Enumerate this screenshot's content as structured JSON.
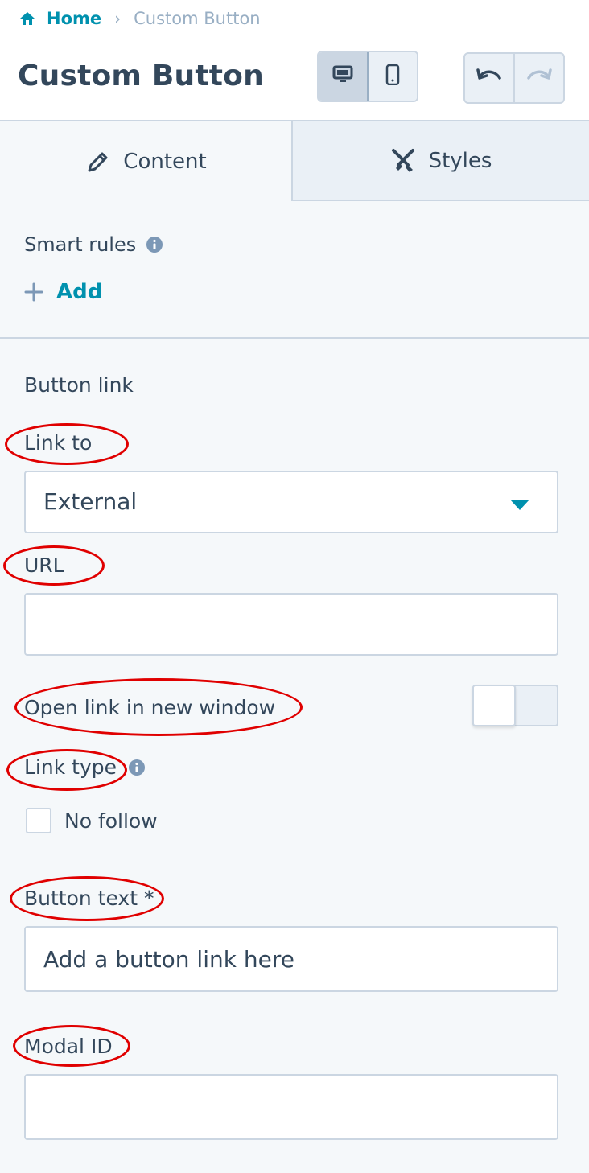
{
  "breadcrumb": {
    "home_icon": "home-icon",
    "home_label": "Home",
    "separator": "›",
    "current_label": "Custom Button"
  },
  "header": {
    "title": "Custom Button",
    "device_toggle": {
      "desktop_icon": "desktop-icon",
      "mobile_icon": "mobile-icon",
      "active": "desktop"
    },
    "history": {
      "undo_icon": "undo-icon",
      "redo_icon": "redo-icon"
    }
  },
  "tabs": [
    {
      "label": "Content",
      "icon": "pencil-icon",
      "active": true
    },
    {
      "label": "Styles",
      "icon": "paintbrush-icon",
      "active": false
    }
  ],
  "smart_rules": {
    "label": "Smart rules",
    "info_icon": "info-icon",
    "add_label": "Add",
    "add_icon": "plus-icon"
  },
  "button_link": {
    "section_label": "Button link",
    "link_to_label": "Link to",
    "link_to_value": "External",
    "url_label": "URL",
    "url_value": "",
    "open_new_window_label": "Open link in new window",
    "open_new_window_enabled": false,
    "link_type_label": "Link type",
    "no_follow_label": "No follow",
    "no_follow_checked": false,
    "button_text_label": "Button text *",
    "button_text_placeholder": "Add a button link here",
    "modal_id_label": "Modal ID",
    "modal_id_value": ""
  },
  "colors": {
    "accent": "#0091ae",
    "text": "#33475b",
    "muted": "#99afc4",
    "border": "#cbd6e2",
    "panel_bg": "#f5f8fa",
    "annotation": "#e00000"
  }
}
